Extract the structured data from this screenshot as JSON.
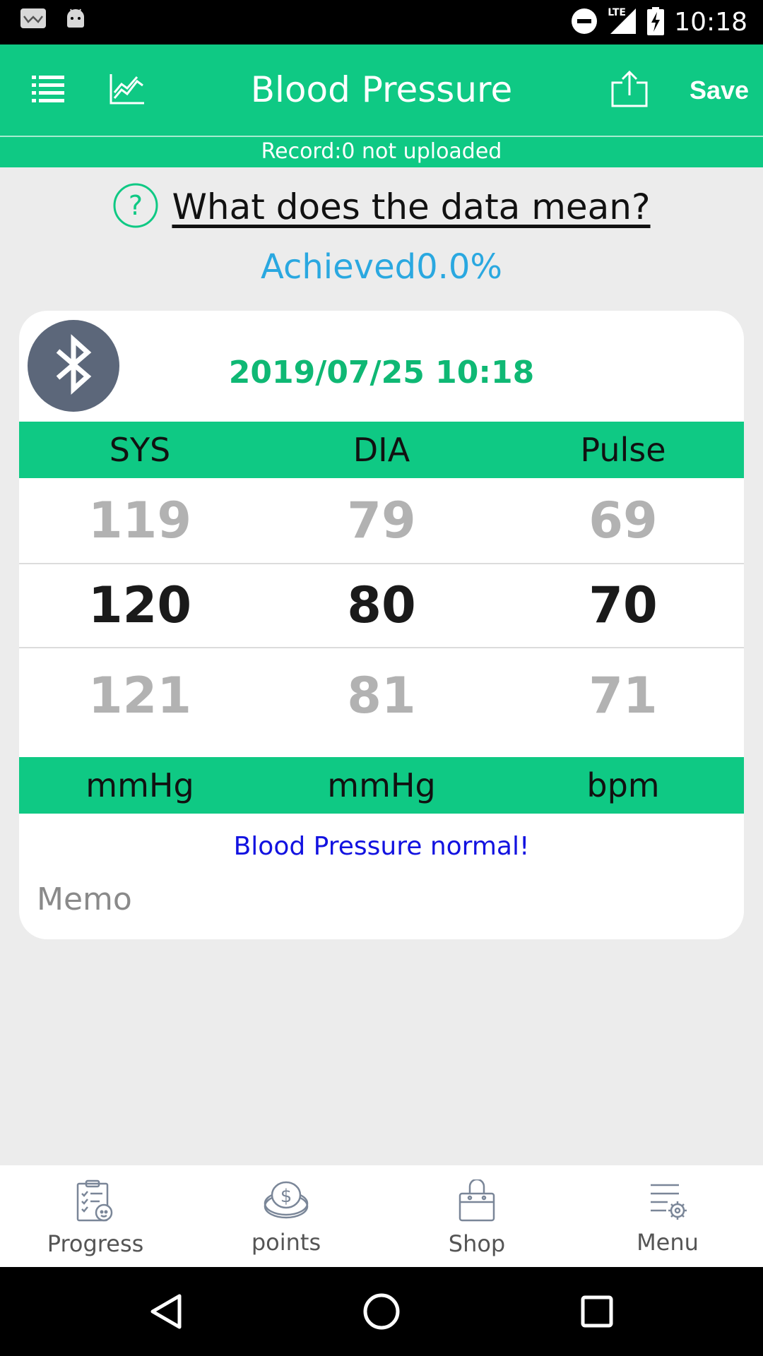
{
  "status_bar": {
    "time": "10:18",
    "network": "LTE",
    "icons": [
      "notification-app-icon",
      "android-icon",
      "do-not-disturb-icon",
      "signal-icon",
      "battery-charging-icon"
    ]
  },
  "app_bar": {
    "title": "Blood Pressure",
    "save_label": "Save",
    "icons": [
      "list-icon",
      "chart-icon",
      "share-upload-icon"
    ]
  },
  "upload_status": "Record:0 not uploaded",
  "help": {
    "link_text": "What does the data mean?",
    "icon": "question-circle-icon"
  },
  "achieved": "Achieved0.0%",
  "reading": {
    "datetime": "2019/07/25 10:18",
    "headers": {
      "sys": "SYS",
      "dia": "DIA",
      "pulse": "Pulse"
    },
    "prev": {
      "sys": "119",
      "dia": "79",
      "pulse": "69"
    },
    "current": {
      "sys": "120",
      "dia": "80",
      "pulse": "70"
    },
    "next": {
      "sys": "121",
      "dia": "81",
      "pulse": "71"
    },
    "units": {
      "sys": "mmHg",
      "dia": "mmHg",
      "pulse": "bpm"
    },
    "status_text": "Blood Pressure normal!",
    "memo_placeholder": "Memo"
  },
  "bottom_nav": [
    {
      "label": "Progress",
      "icon": "progress-clipboard-icon"
    },
    {
      "label": "points",
      "icon": "coins-icon"
    },
    {
      "label": "Shop",
      "icon": "shopping-bag-icon"
    },
    {
      "label": "Menu",
      "icon": "menu-settings-icon"
    }
  ],
  "colors": {
    "primary": "#0fc984",
    "accent_text": "#2aa8e0",
    "date_text": "#0fb874",
    "status_text": "#1212e0",
    "bluetooth_bg": "#5c677a"
  }
}
